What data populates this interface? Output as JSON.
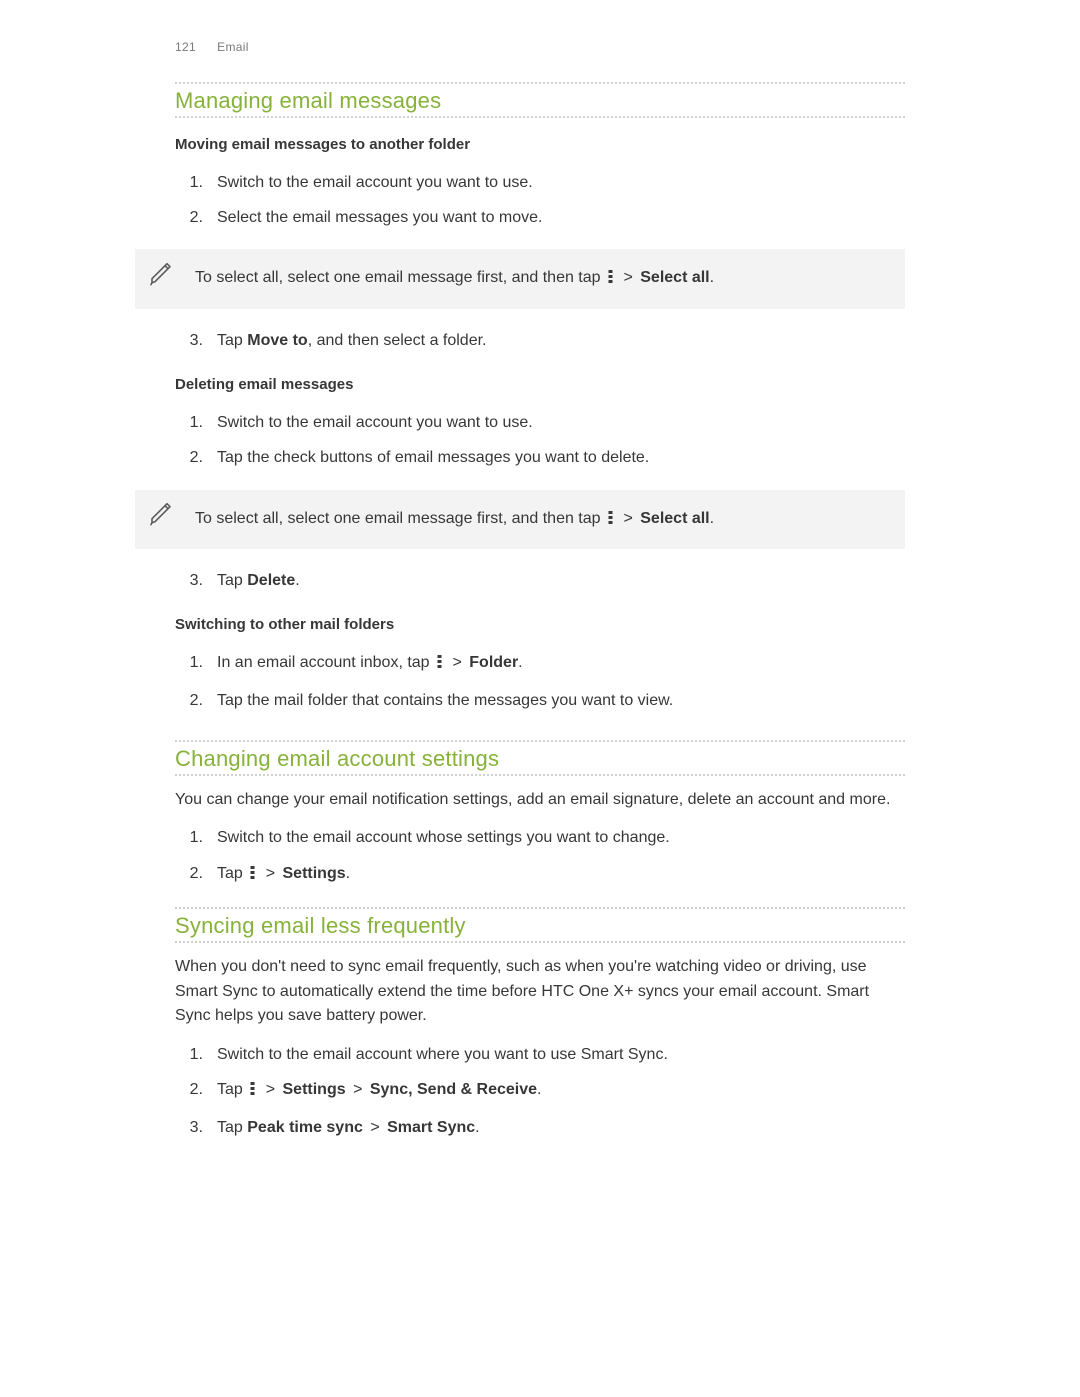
{
  "header": {
    "page_number": "121",
    "section": "Email"
  },
  "sec1": {
    "title": "Managing email messages",
    "sub1": {
      "title": "Moving email messages to another folder",
      "steps": [
        "Switch to the email account you want to use.",
        "Select the email messages you want to move."
      ],
      "note_pre": "To select all, select one email message first, and then tap ",
      "note_post": " > ",
      "note_bold": "Select all",
      "note_end": ".",
      "step3_a": "Tap ",
      "step3_b": "Move to",
      "step3_c": ", and then select a folder."
    },
    "sub2": {
      "title": "Deleting email messages",
      "steps": [
        "Switch to the email account you want to use.",
        "Tap the check buttons of email messages you want to delete."
      ],
      "note_pre": "To select all, select one email message first, and then tap ",
      "note_post": " > ",
      "note_bold": "Select all",
      "note_end": ".",
      "step3_a": "Tap ",
      "step3_b": "Delete",
      "step3_c": "."
    },
    "sub3": {
      "title": "Switching to other mail folders",
      "step1_a": "In an email account inbox, tap ",
      "step1_post": " > ",
      "step1_bold": "Folder",
      "step1_end": ".",
      "step2": "Tap the mail folder that contains the messages you want to view."
    }
  },
  "sec2": {
    "title": "Changing email account settings",
    "intro": "You can change your email notification settings, add an email signature, delete an account and more.",
    "step1": "Switch to the email account whose settings you want to change.",
    "step2_a": "Tap ",
    "step2_post": " > ",
    "step2_bold": "Settings",
    "step2_end": "."
  },
  "sec3": {
    "title": "Syncing email less frequently",
    "intro": "When you don't need to sync email frequently, such as when you're watching video or driving, use Smart Sync to automatically extend the time before HTC One X+ syncs your email account. Smart Sync helps you save battery power.",
    "step1": "Switch to the email account where you want to use Smart Sync.",
    "step2_a": "Tap ",
    "step2_post1": " > ",
    "step2_b1": "Settings",
    "step2_post2": " > ",
    "step2_b2": "Sync, Send & Receive",
    "step2_end": ".",
    "step3_a": "Tap ",
    "step3_b1": "Peak time sync",
    "step3_post": " > ",
    "step3_b2": "Smart Sync",
    "step3_end": "."
  },
  "numbers": {
    "n1": "1.",
    "n2": "2.",
    "n3": "3."
  }
}
